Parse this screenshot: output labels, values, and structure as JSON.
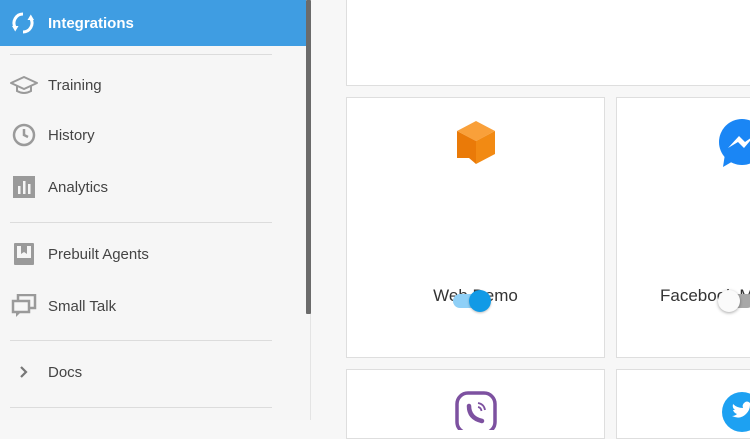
{
  "sidebar": {
    "active": {
      "label": "Integrations",
      "icon": "refresh-icon"
    },
    "items": [
      {
        "label": "Training",
        "icon": "graduation-cap-icon"
      },
      {
        "label": "History",
        "icon": "clock-icon"
      },
      {
        "label": "Analytics",
        "icon": "bar-chart-icon"
      },
      {
        "label": "Prebuilt Agents",
        "icon": "bookmark-book-icon"
      },
      {
        "label": "Small Talk",
        "icon": "chat-bubbles-icon"
      },
      {
        "label": "Docs",
        "icon": "chevron-right-icon"
      }
    ]
  },
  "cards": [
    {
      "title": "Web Demo",
      "icon": "cube-chat-icon",
      "enabled": true
    },
    {
      "title": "Facebook Messenger",
      "title_visible": "Facebook M",
      "icon": "messenger-icon",
      "enabled": false
    },
    {
      "title": "",
      "icon": "viber-icon"
    },
    {
      "title": "",
      "icon": "twitter-icon"
    }
  ],
  "colors": {
    "accent": "#3f9de2",
    "toggle_on": "#119ae6",
    "web_demo_orange": "#f07c0a",
    "messenger_blue": "#1a86f5",
    "viber_purple": "#7d51a0",
    "twitter_blue": "#1da1f2"
  }
}
